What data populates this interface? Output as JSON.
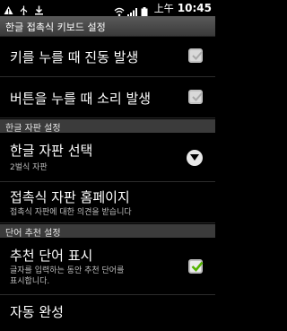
{
  "status_bar": {
    "ampm": "上午",
    "time": "10:45",
    "icons": [
      "warning-icon",
      "usb-icon",
      "download-icon",
      "wifi-icon",
      "signal-icon",
      "battery-icon"
    ]
  },
  "title_bar": {
    "title": "한글 접촉식 키보드 설정"
  },
  "settings": {
    "vibrate": {
      "title": "키를 누를 때 진동 발생",
      "checked": false
    },
    "sound": {
      "title": "버튼을 누를 때 소리 발생",
      "checked": false
    },
    "hangul_header": "한글 자판 설정",
    "layout_select": {
      "title": "한글 자판 선택",
      "summary": "2벌식 자판"
    },
    "homepage": {
      "title": "접촉식 자판 홈페이지",
      "summary": "접촉식 자판에 대한 의견을 받습니다"
    },
    "word_header": "단어 추천 설정",
    "suggestions": {
      "title": "추천 단어 표시",
      "summary_line1": "글자를 입력하는 동안 추천 단어를",
      "summary_line2": "표시합니다.",
      "checked": true
    },
    "autocomplete": {
      "title": "자동 완성"
    }
  },
  "colors": {
    "check_green": "#53b300",
    "background": "#000000",
    "header_bg": "#3b3b3b"
  }
}
